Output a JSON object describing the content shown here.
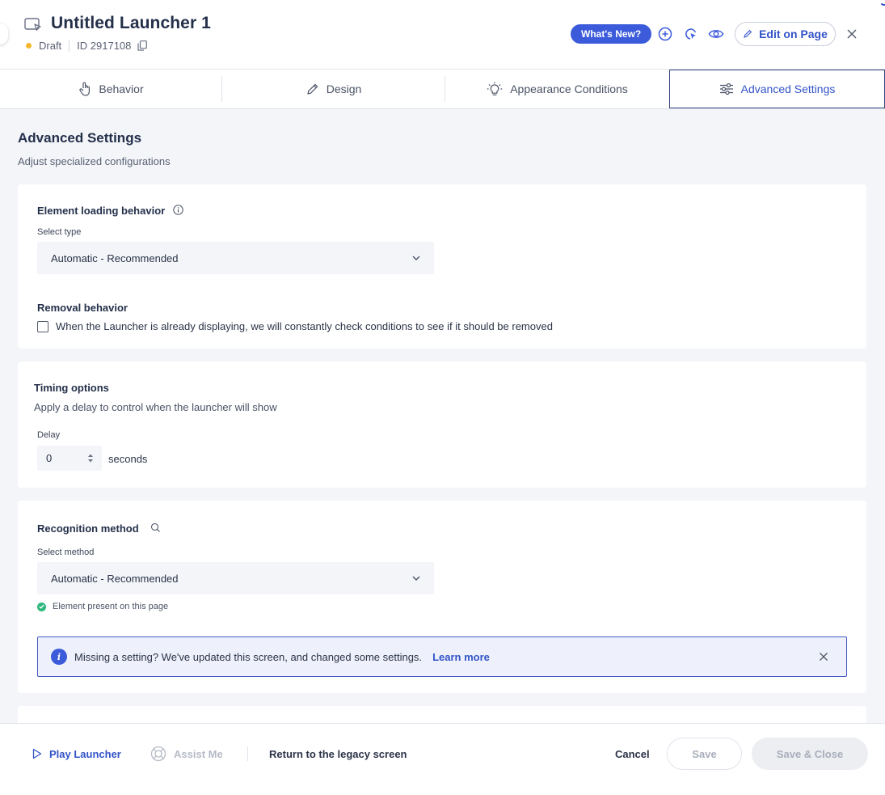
{
  "header": {
    "title": "Untitled Launcher 1",
    "status": "Draft",
    "id_text": "ID 2917108",
    "whats_new": "What's New?",
    "edit_on_page": "Edit on Page"
  },
  "tabs": [
    {
      "label": "Behavior",
      "icon": "hand-pointer-icon"
    },
    {
      "label": "Design",
      "icon": "pencil-icon"
    },
    {
      "label": "Appearance Conditions",
      "icon": "lightbulb-icon"
    },
    {
      "label": "Advanced Settings",
      "icon": "sliders-icon",
      "active": true
    }
  ],
  "main": {
    "title": "Advanced Settings",
    "subtitle": "Adjust specialized configurations"
  },
  "element_loading": {
    "title": "Element loading behavior",
    "select_label": "Select type",
    "select_value": "Automatic - Recommended",
    "removal_title": "Removal behavior",
    "removal_checkbox": "When the Launcher is already displaying, we will constantly check conditions to see if it should be removed",
    "removal_checked": false
  },
  "timing": {
    "title": "Timing options",
    "subtitle": "Apply a delay to control when the launcher will show",
    "delay_label": "Delay",
    "delay_value": "0",
    "delay_unit": "seconds"
  },
  "recognition": {
    "title": "Recognition method",
    "select_label": "Select method",
    "select_value": "Automatic - Recommended",
    "status_text": "Element present on this page",
    "banner_text": "Missing a setting? We've updated this screen, and changed some settings.",
    "banner_link": "Learn more"
  },
  "footer": {
    "play": "Play Launcher",
    "assist": "Assist Me",
    "legacy": "Return to the legacy screen",
    "cancel": "Cancel",
    "save": "Save",
    "save_close": "Save & Close"
  },
  "colors": {
    "accent": "#3b5bdb",
    "draft_dot": "#f5b72e",
    "success": "#2eb67d",
    "background": "#f3f5f9"
  }
}
